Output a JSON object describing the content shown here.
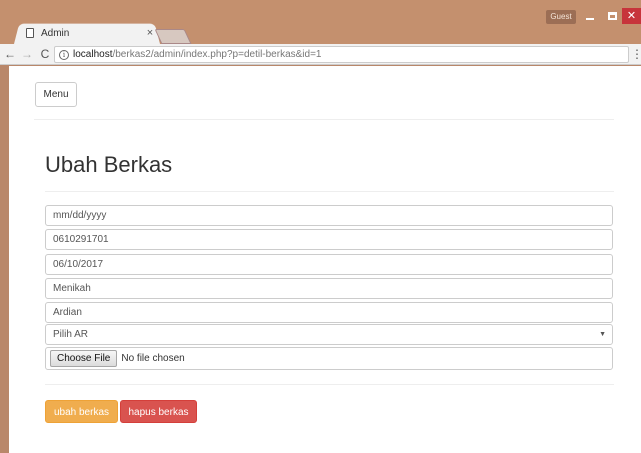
{
  "browser": {
    "tab_title": "Admin",
    "tab_close": "×",
    "guest_label": "Guest",
    "url_host": "localhost",
    "url_path": "/berkas2/admin/index.php?p=detil-berkas&id=1",
    "back_glyph": "←",
    "forward_glyph": "→",
    "reload_glyph": "C",
    "info_glyph": "i",
    "menu_glyph": "⋮"
  },
  "page": {
    "menu_label": "Menu",
    "title": "Ubah Berkas",
    "fields": {
      "date_placeholder": "mm/dd/yyyy",
      "nomor": "0610291701",
      "tanggal": "06/10/2017",
      "status": "Menikah",
      "nama": "Ardian",
      "ar_select": "Pilih AR"
    },
    "file": {
      "button": "Choose File",
      "status": "No file chosen"
    },
    "actions": {
      "update": "ubah berkas",
      "delete": "hapus berkas"
    }
  },
  "colors": {
    "warning": "#f0ad4e",
    "danger": "#d9534f",
    "window_frame": "#c4906e"
  }
}
